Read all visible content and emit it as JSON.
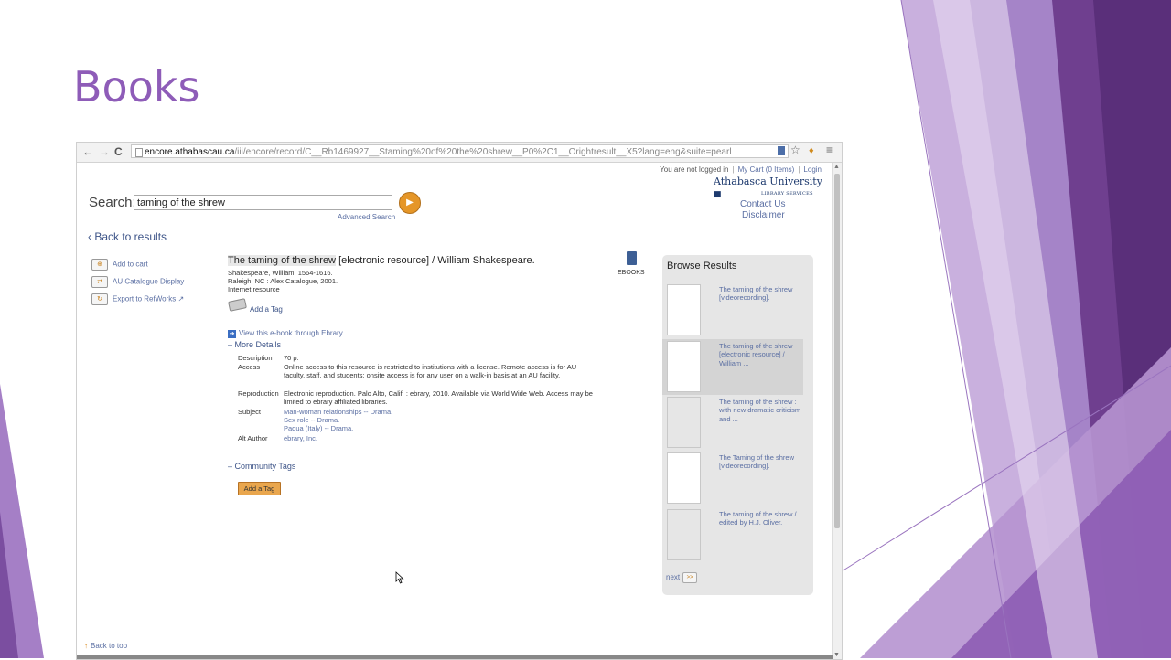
{
  "slide": {
    "title": "Books"
  },
  "browser": {
    "url_domain": "encore.athabascau.ca",
    "url_path": "/iii/encore/record/C__Rb1469927__Staming%20of%20the%20shrew__P0%2C1__Orightresult__X5?lang=eng&suite=pearl",
    "back_glyph": "←",
    "forward_glyph": "→",
    "reload_glyph": "C"
  },
  "header": {
    "not_logged_in": "You are not logged in",
    "cart": "My Cart (0 Items)",
    "login": "Login",
    "separator": "|",
    "logo_main": "Athabasca University",
    "logo_sub": "LIBRARY SERVICES",
    "contact": "Contact Us",
    "disclaimer": "Disclaimer"
  },
  "search": {
    "label": "Search:",
    "value": "taming of the shrew",
    "advanced": "Advanced Search",
    "go_glyph": "▶"
  },
  "back_to_results": "‹ Back to results",
  "actions": [
    {
      "label": "Add to cart",
      "icon": "cart-icon"
    },
    {
      "label": "AU Catalogue Display",
      "icon": "catalogue-icon"
    },
    {
      "label": "Export to RefWorks",
      "icon": "export-icon"
    }
  ],
  "record": {
    "title_hl": "The taming of the shrew",
    "title_rest": " [electronic resource] / William Shakespeare.",
    "author": "Shakespeare, William, 1564-1616.",
    "publisher": "Raleigh, NC : Alex Catalogue, 2001.",
    "format": "Internet resource",
    "add_tag": "Add a Tag",
    "view_ebook": "View this e-book through Ebrary.",
    "format_badge": "EBOOKS",
    "more_details": "More Details",
    "details": {
      "description_label": "Description",
      "description": "70 p.",
      "access_label": "Access",
      "access": "Online access to this resource is restricted to institutions with a license. Remote access is for AU faculty, staff, and students; onsite access is for any user on a walk-in basis at an AU facility.",
      "reproduction_label": "Reproduction",
      "reproduction": "Electronic reproduction. Palo Alto, Calif. : ebrary, 2010. Available via World Wide Web. Access may be limited to ebrary affiliated libraries.",
      "subject_label": "Subject",
      "subjects": [
        "Man-woman relationships -- Drama.",
        "Sex role -- Drama.",
        "Padua (Italy) -- Drama."
      ],
      "alt_author_label": "Alt Author",
      "alt_author": "ebrary, Inc."
    },
    "community_tags": "Community Tags",
    "add_tag_button": "Add a Tag"
  },
  "browse": {
    "title": "Browse Results",
    "items": [
      "The taming of the shrew [videorecording].",
      "The taming of the shrew [electronic resource] / William ...",
      "The taming of the shrew : with new dramatic criticism and ...",
      "The Taming of the shrew [videorecording].",
      "The taming of the shrew / edited by H.J. Oliver."
    ],
    "next": "next",
    "next_glyph": ">>"
  },
  "back_to_top": "Back to top"
}
